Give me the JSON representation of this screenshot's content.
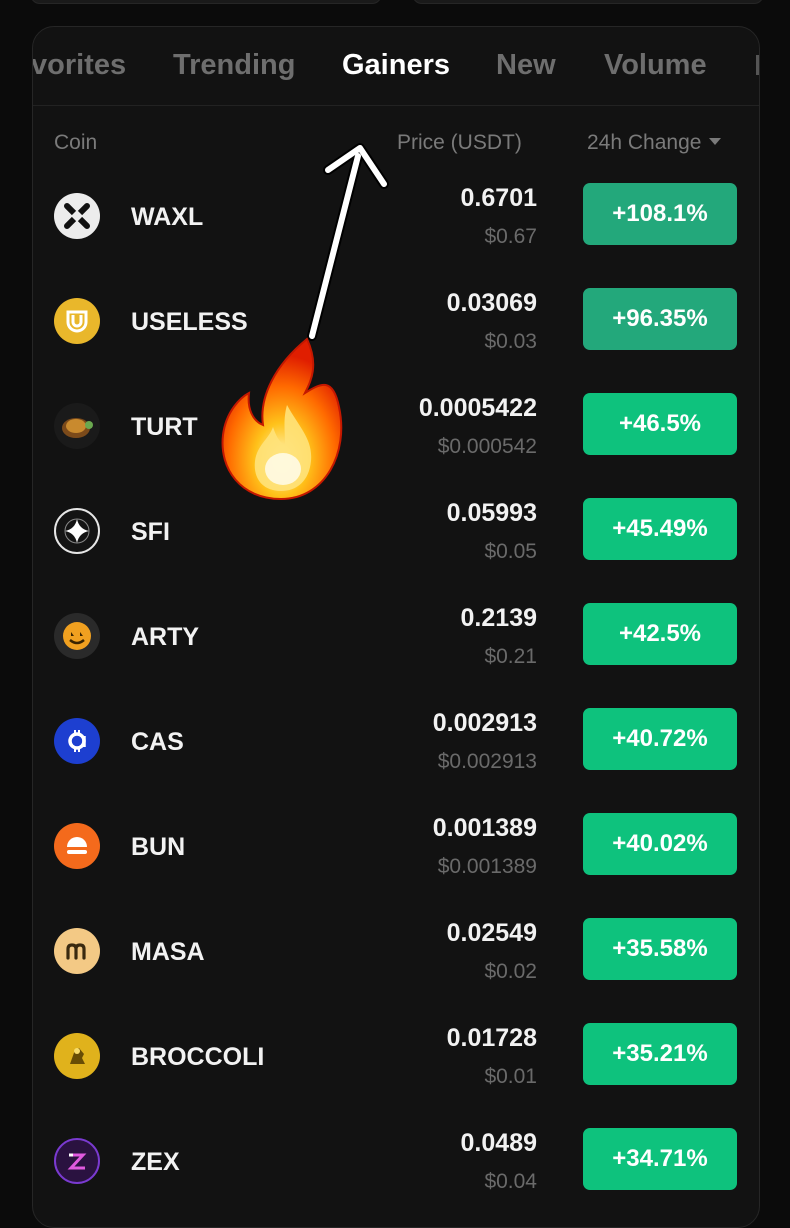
{
  "tabs": [
    {
      "label": "vorites"
    },
    {
      "label": "Trending"
    },
    {
      "label": "Gainers",
      "active": true
    },
    {
      "label": "New"
    },
    {
      "label": "Volume"
    }
  ],
  "columns": {
    "coin": "Coin",
    "price": "Price (USDT)",
    "change": "24h Change"
  },
  "rows": [
    {
      "symbol": "WAXL",
      "price": "0.6701",
      "usd": "$0.67",
      "change": "+108.1%",
      "icon": "waxl-x-icon",
      "color": "#e8e8e8"
    },
    {
      "symbol": "USELESS",
      "price": "0.03069",
      "usd": "$0.03",
      "change": "+96.35%",
      "icon": "useless-shield-icon",
      "color": "#e9b72b"
    },
    {
      "symbol": "TURT",
      "price": "0.0005422",
      "usd": "$0.000542",
      "change": "+46.5%",
      "icon": "turtle-icon",
      "color": "#7b4a1a"
    },
    {
      "symbol": "SFI",
      "price": "0.05993",
      "usd": "$0.05",
      "change": "+45.49%",
      "icon": "sparkle-icon",
      "color": "#151515"
    },
    {
      "symbol": "ARTY",
      "price": "0.2139",
      "usd": "$0.21",
      "change": "+42.5%",
      "icon": "arty-face-icon",
      "color": "#f0a020"
    },
    {
      "symbol": "CAS",
      "price": "0.002913",
      "usd": "$0.002913",
      "change": "+40.72%",
      "icon": "cas-coin-icon",
      "color": "#1d3fd0"
    },
    {
      "symbol": "BUN",
      "price": "0.001389",
      "usd": "$0.001389",
      "change": "+40.02%",
      "icon": "bun-icon",
      "color": "#f46a1c"
    },
    {
      "symbol": "MASA",
      "price": "0.02549",
      "usd": "$0.02",
      "change": "+35.58%",
      "icon": "masa-m-icon",
      "color": "#f3c985"
    },
    {
      "symbol": "BROCCOLI",
      "price": "0.01728",
      "usd": "$0.01",
      "change": "+35.21%",
      "icon": "broccoli-icon",
      "color": "#e0b21c"
    },
    {
      "symbol": "ZEX",
      "price": "0.0489",
      "usd": "$0.04",
      "change": "+34.71%",
      "icon": "zex-icon",
      "color": "#2a1240"
    }
  ],
  "overlay": {
    "arrow": "arrow-icon",
    "fire": "fire-emoji-icon"
  },
  "colors": {
    "up": "#0ec27d",
    "up_dim": "#23a87b",
    "bg": "#121212"
  }
}
